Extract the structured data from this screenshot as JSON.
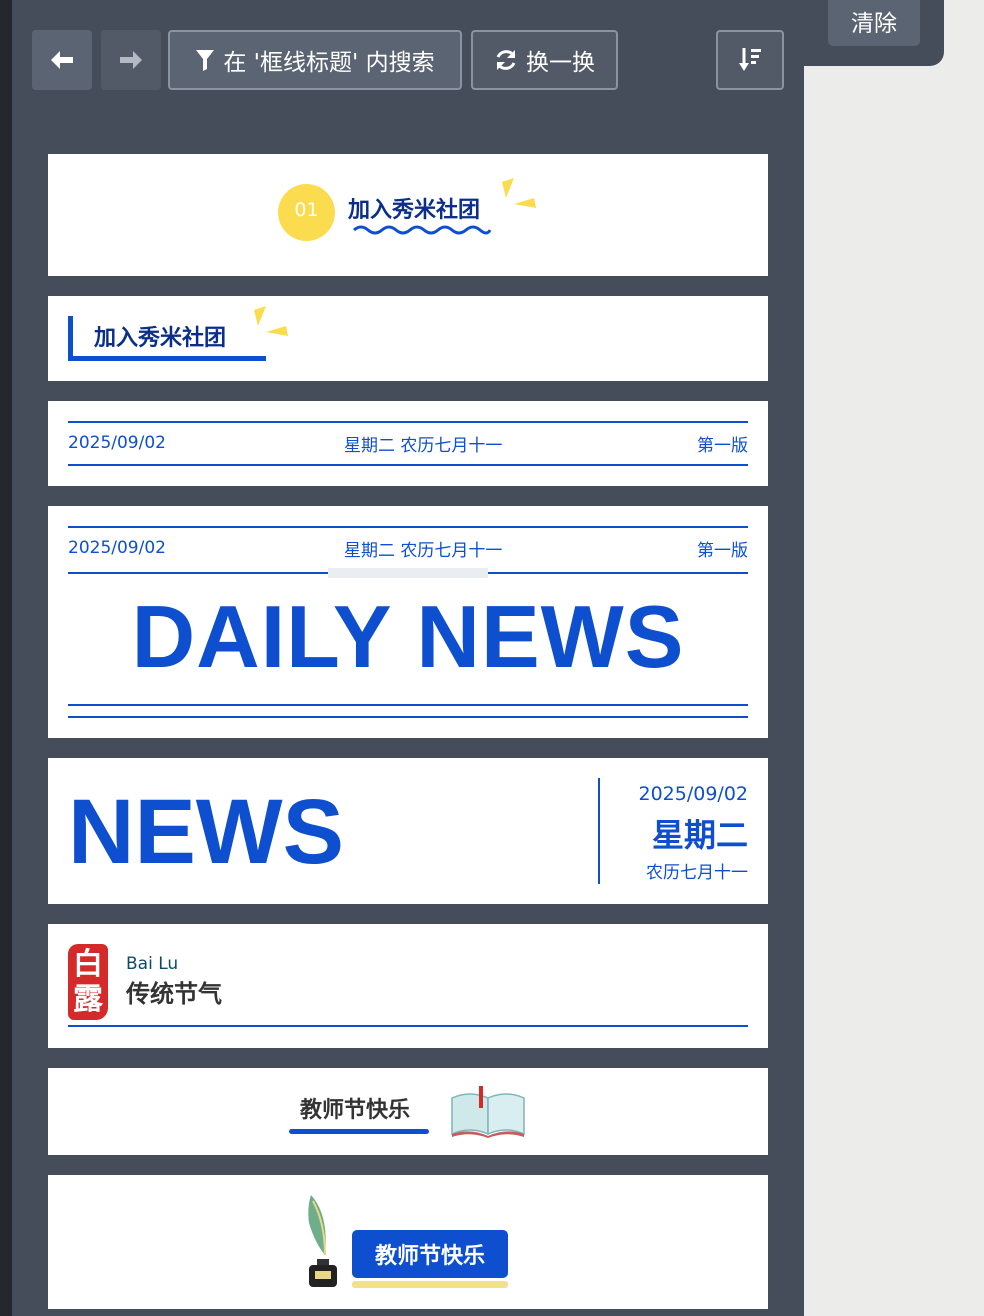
{
  "toolbar": {
    "search_label": "在 '框线标题' 内搜索",
    "shuffle_label": "换一换",
    "clear_label": "清除"
  },
  "cards": {
    "numbered_title": {
      "number": "01",
      "title": "加入秀米社团"
    },
    "bracket_title": {
      "title": "加入秀米社团"
    },
    "dateline": {
      "date": "2025/09/02",
      "weekday_lunar": "星期二 农历七月十一",
      "edition": "第一版"
    },
    "daily_news": {
      "date": "2025/09/02",
      "weekday_lunar": "星期二 农历七月十一",
      "edition": "第一版",
      "headline": "DAILY NEWS"
    },
    "news_block": {
      "headline": "NEWS",
      "date": "2025/09/02",
      "weekday": "星期二",
      "lunar": "农历七月十一"
    },
    "solar_term": {
      "seal_char_1": "白",
      "seal_char_2": "露",
      "english": "Bai Lu",
      "chinese": "传统节气"
    },
    "teachers_day_book": {
      "title": "教师节快乐"
    },
    "teachers_day_pill": {
      "title": "教师节快乐"
    }
  },
  "colors": {
    "panel": "#454d5a",
    "accent_blue": "#0e4fcf",
    "navy": "#0b2e8a",
    "yellow": "#fbdc4f",
    "seal_red": "#d42a2a"
  }
}
